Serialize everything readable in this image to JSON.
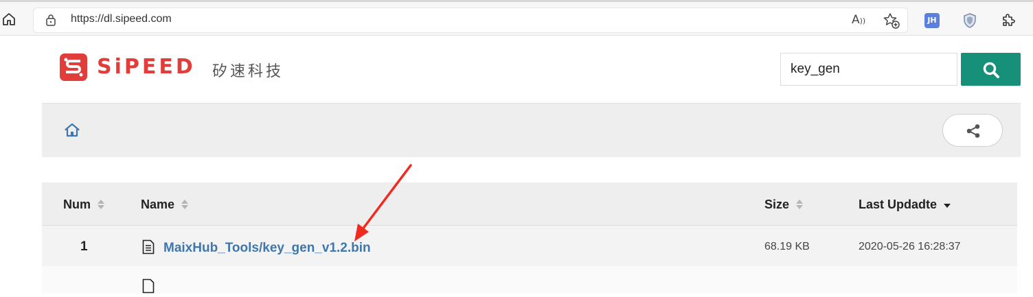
{
  "browser": {
    "url": "https://dl.sipeed.com",
    "read_aloud_label": "Ă",
    "profile_extension_label": "JH"
  },
  "header": {
    "logo_text": "SiPEED",
    "logo_cn": "矽速科技"
  },
  "search": {
    "value": "key_gen"
  },
  "table": {
    "columns": [
      "Num",
      "Name",
      "Size",
      "Last Updadte"
    ],
    "rows": [
      {
        "num": "1",
        "name": "MaixHub_Tools/key_gen_v1.2.bin",
        "size": "68.19 KB",
        "updated": "2020-05-26 16:28:37"
      }
    ]
  },
  "colors": {
    "brand_red": "#e13d3a",
    "search_button": "#17907a",
    "link_blue": "#3f77ad",
    "annotation_arrow": "#f02a1e"
  }
}
